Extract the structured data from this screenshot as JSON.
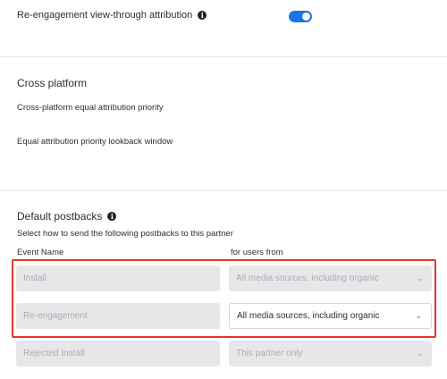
{
  "reengagement": {
    "label": "Re-engagement view-through attribution",
    "info_icon": "info-icon",
    "toggle_on": true,
    "toggle_color": "#1a73e8"
  },
  "cross_platform": {
    "title": "Cross platform",
    "equal_priority": "Cross-platform equal attribution priority",
    "lookback_window": "Equal attribution priority lookback window"
  },
  "postbacks": {
    "title": "Default postbacks",
    "info_icon": "info-icon",
    "description": "Select how to send the following postbacks to this partner",
    "col_event": "Event Name",
    "col_users": "for users from",
    "rows": [
      {
        "event": "Install",
        "source": "All media sources, including organic",
        "active": false
      },
      {
        "event": "Re-engagement",
        "source": "All media sources, including organic",
        "active": true
      },
      {
        "event": "Rejected Install",
        "source": "This partner only",
        "active": false
      }
    ],
    "highlight_color": "#e2372b"
  }
}
